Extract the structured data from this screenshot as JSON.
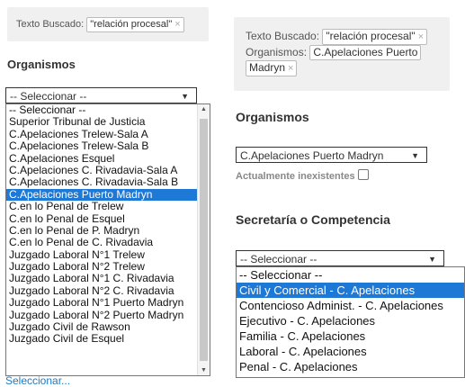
{
  "left": {
    "filter": {
      "label": "Texto Buscado:",
      "chip": "\"relación procesal\"",
      "remove": "×"
    },
    "organismos_heading": "Organismos",
    "select_value": "-- Seleccionar --",
    "options": [
      "-- Seleccionar --",
      "Superior Tribunal de Justicia",
      "C.Apelaciones Trelew-Sala A",
      "C.Apelaciones Trelew-Sala B",
      "C.Apelaciones Esquel",
      "C.Apelaciones C. Rivadavia-Sala A",
      "C.Apelaciones C. Rivadavia-Sala B",
      "C.Apelaciones Puerto Madryn",
      "C.en lo Penal de Trelew",
      "C.en lo Penal de Esquel",
      "C.en lo Penal de P. Madryn",
      "C.en lo Penal de C. Rivadavia",
      "Juzgado Laboral N°1 Trelew",
      "Juzgado Laboral N°2 Trelew",
      "Juzgado Laboral N°1 C. Rivadavia",
      "Juzgado Laboral N°2 C. Rivadavia",
      "Juzgado Laboral N°1 Puerto Madryn",
      "Juzgado Laboral N°2 Puerto Madryn",
      "Juzgado Civil de Rawson",
      "Juzgado Civil de Esquel"
    ],
    "selected_index": 7,
    "link": "Seleccionar..."
  },
  "right": {
    "filter": {
      "label1": "Texto Buscado:",
      "chip1": "\"relación procesal\"",
      "label2": "Organismos:",
      "chip2a": "C.Apelaciones Puerto",
      "chip2b": "Madryn",
      "remove": "×"
    },
    "organismos_heading": "Organismos",
    "organismos_value": "C.Apelaciones Puerto Madryn",
    "inexistentes_label": "Actualmente inexistentes",
    "secretaria_heading": "Secretaría o Competencia",
    "select_value": "-- Seleccionar --",
    "options": [
      "-- Seleccionar --",
      "Civil y Comercial - C. Apelaciones",
      "Contencioso Administ. - C. Apelaciones",
      "Ejecutivo - C. Apelaciones",
      "Familia - C. Apelaciones",
      "Laboral - C. Apelaciones",
      "Penal - C. Apelaciones"
    ],
    "selected_index": 1
  }
}
